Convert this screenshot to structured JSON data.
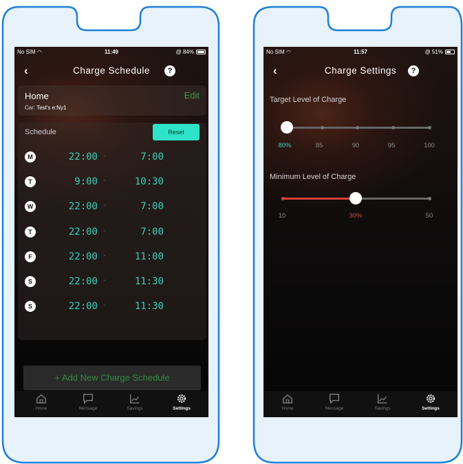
{
  "left_phone": {
    "status_bar": {
      "carrier": "No SIM",
      "time": "11:49",
      "battery": "84%",
      "battery_level": 0.84
    },
    "nav": {
      "title": "Charge Schedule",
      "help": "?"
    },
    "home_card": {
      "name": "Home",
      "edit_label": "Edit",
      "car_prefix": "Car:",
      "car_name": "Test's e:Ny1"
    },
    "schedule": {
      "label": "Schedule",
      "reset_label": "Reset",
      "days": [
        {
          "letter": "M",
          "start": "22:00",
          "end": "7:00"
        },
        {
          "letter": "T",
          "start": "9:00",
          "end": "10:30"
        },
        {
          "letter": "W",
          "start": "22:00",
          "end": "7:00"
        },
        {
          "letter": "T",
          "start": "22:00",
          "end": "7:00"
        },
        {
          "letter": "F",
          "start": "22:00",
          "end": "11:00"
        },
        {
          "letter": "S",
          "start": "22:00",
          "end": "11:30"
        },
        {
          "letter": "S",
          "start": "22:00",
          "end": "11:30"
        }
      ],
      "separator": "-"
    },
    "add_button_label": "+ Add New Charge Schedule"
  },
  "right_phone": {
    "status_bar": {
      "carrier": "No SIM",
      "time": "11:57",
      "battery": "51%",
      "battery_level": 0.51
    },
    "nav": {
      "title": "Charge Settings",
      "help": "?"
    },
    "target": {
      "label": "Target Level of Charge",
      "ticks": [
        "80%",
        "85",
        "90",
        "95",
        "100"
      ],
      "value": 80,
      "min": 80,
      "max": 100,
      "selected_color": "#3ad1b7"
    },
    "minimum": {
      "label": "Minimum Level of Charge",
      "ticks": [
        "10",
        "30%",
        "50"
      ],
      "value": 30,
      "min": 10,
      "max": 50,
      "fill_color": "#d9423a"
    }
  },
  "tab_bar": {
    "items": [
      {
        "label": "Home",
        "icon": "home-icon"
      },
      {
        "label": "Message",
        "icon": "message-icon"
      },
      {
        "label": "Savings",
        "icon": "chart-icon"
      },
      {
        "label": "Settings",
        "icon": "gear-icon"
      }
    ],
    "active": "Settings"
  },
  "colors": {
    "accent_teal": "#2fe3c8",
    "edit_green": "#3c9a4a",
    "outline_blue": "#1e7fd6",
    "bg_tint": "#e8f2fb"
  }
}
